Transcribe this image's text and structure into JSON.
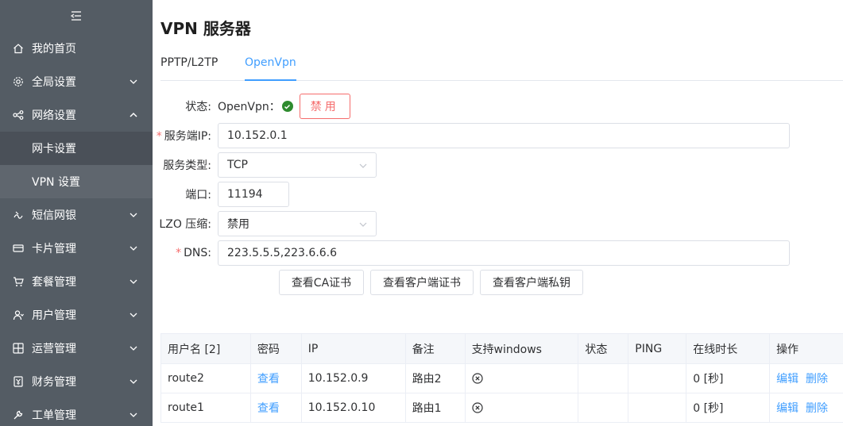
{
  "sidebar": {
    "items": [
      {
        "label": "我的首页",
        "icon": "home-icon"
      },
      {
        "label": "全局设置",
        "icon": "gear-icon"
      },
      {
        "label": "网络设置",
        "icon": "network-icon"
      },
      {
        "label": "短信网银",
        "icon": "sms-icon"
      },
      {
        "label": "卡片管理",
        "icon": "card-icon"
      },
      {
        "label": "套餐管理",
        "icon": "cart-icon"
      },
      {
        "label": "用户管理",
        "icon": "users-icon"
      },
      {
        "label": "运营管理",
        "icon": "ops-icon"
      },
      {
        "label": "财务管理",
        "icon": "finance-icon"
      },
      {
        "label": "工单管理",
        "icon": "wrench-icon"
      }
    ],
    "submenu": [
      {
        "label": "网卡设置"
      },
      {
        "label": "VPN 设置"
      }
    ]
  },
  "page": {
    "title": "VPN 服务器",
    "tabs": [
      {
        "label": "PPTP/L2TP"
      },
      {
        "label": "OpenVpn"
      }
    ]
  },
  "form": {
    "status_label": "状态:",
    "status_name": "OpenVpn：",
    "disable_button": "禁用",
    "server_ip_label": "服务端IP:",
    "server_ip_value": "10.152.0.1",
    "service_type_label": "服务类型:",
    "service_type_value": "TCP",
    "port_label": "端口:",
    "port_value": "11194",
    "lzo_label": "LZO 压缩:",
    "lzo_value": "禁用",
    "dns_label": "DNS:",
    "dns_value": "223.5.5.5,223.6.6.6",
    "view_ca_button": "查看CA证书",
    "view_client_cert_button": "查看客户端证书",
    "view_client_key_button": "查看客户端私钥"
  },
  "table": {
    "headers": [
      "用户名 [2]",
      "密码",
      "IP",
      "备注",
      "支持windows",
      "状态",
      "PING",
      "在线时长",
      "操作"
    ],
    "rows": [
      {
        "username": "route2",
        "password": "查看",
        "ip": "10.152.0.9",
        "note": "路由2",
        "status": "",
        "ping": "",
        "online": "0 [秒]",
        "edit": "编辑",
        "delete": "删除"
      },
      {
        "username": "route1",
        "password": "查看",
        "ip": "10.152.0.10",
        "note": "路由1",
        "status": "",
        "ping": "",
        "online": "0 [秒]",
        "edit": "编辑",
        "delete": "删除"
      }
    ]
  },
  "colors": {
    "sidebar_bg": "#545c64",
    "accent": "#409eff",
    "danger": "#f56c6c",
    "success": "#2e8b2e"
  }
}
